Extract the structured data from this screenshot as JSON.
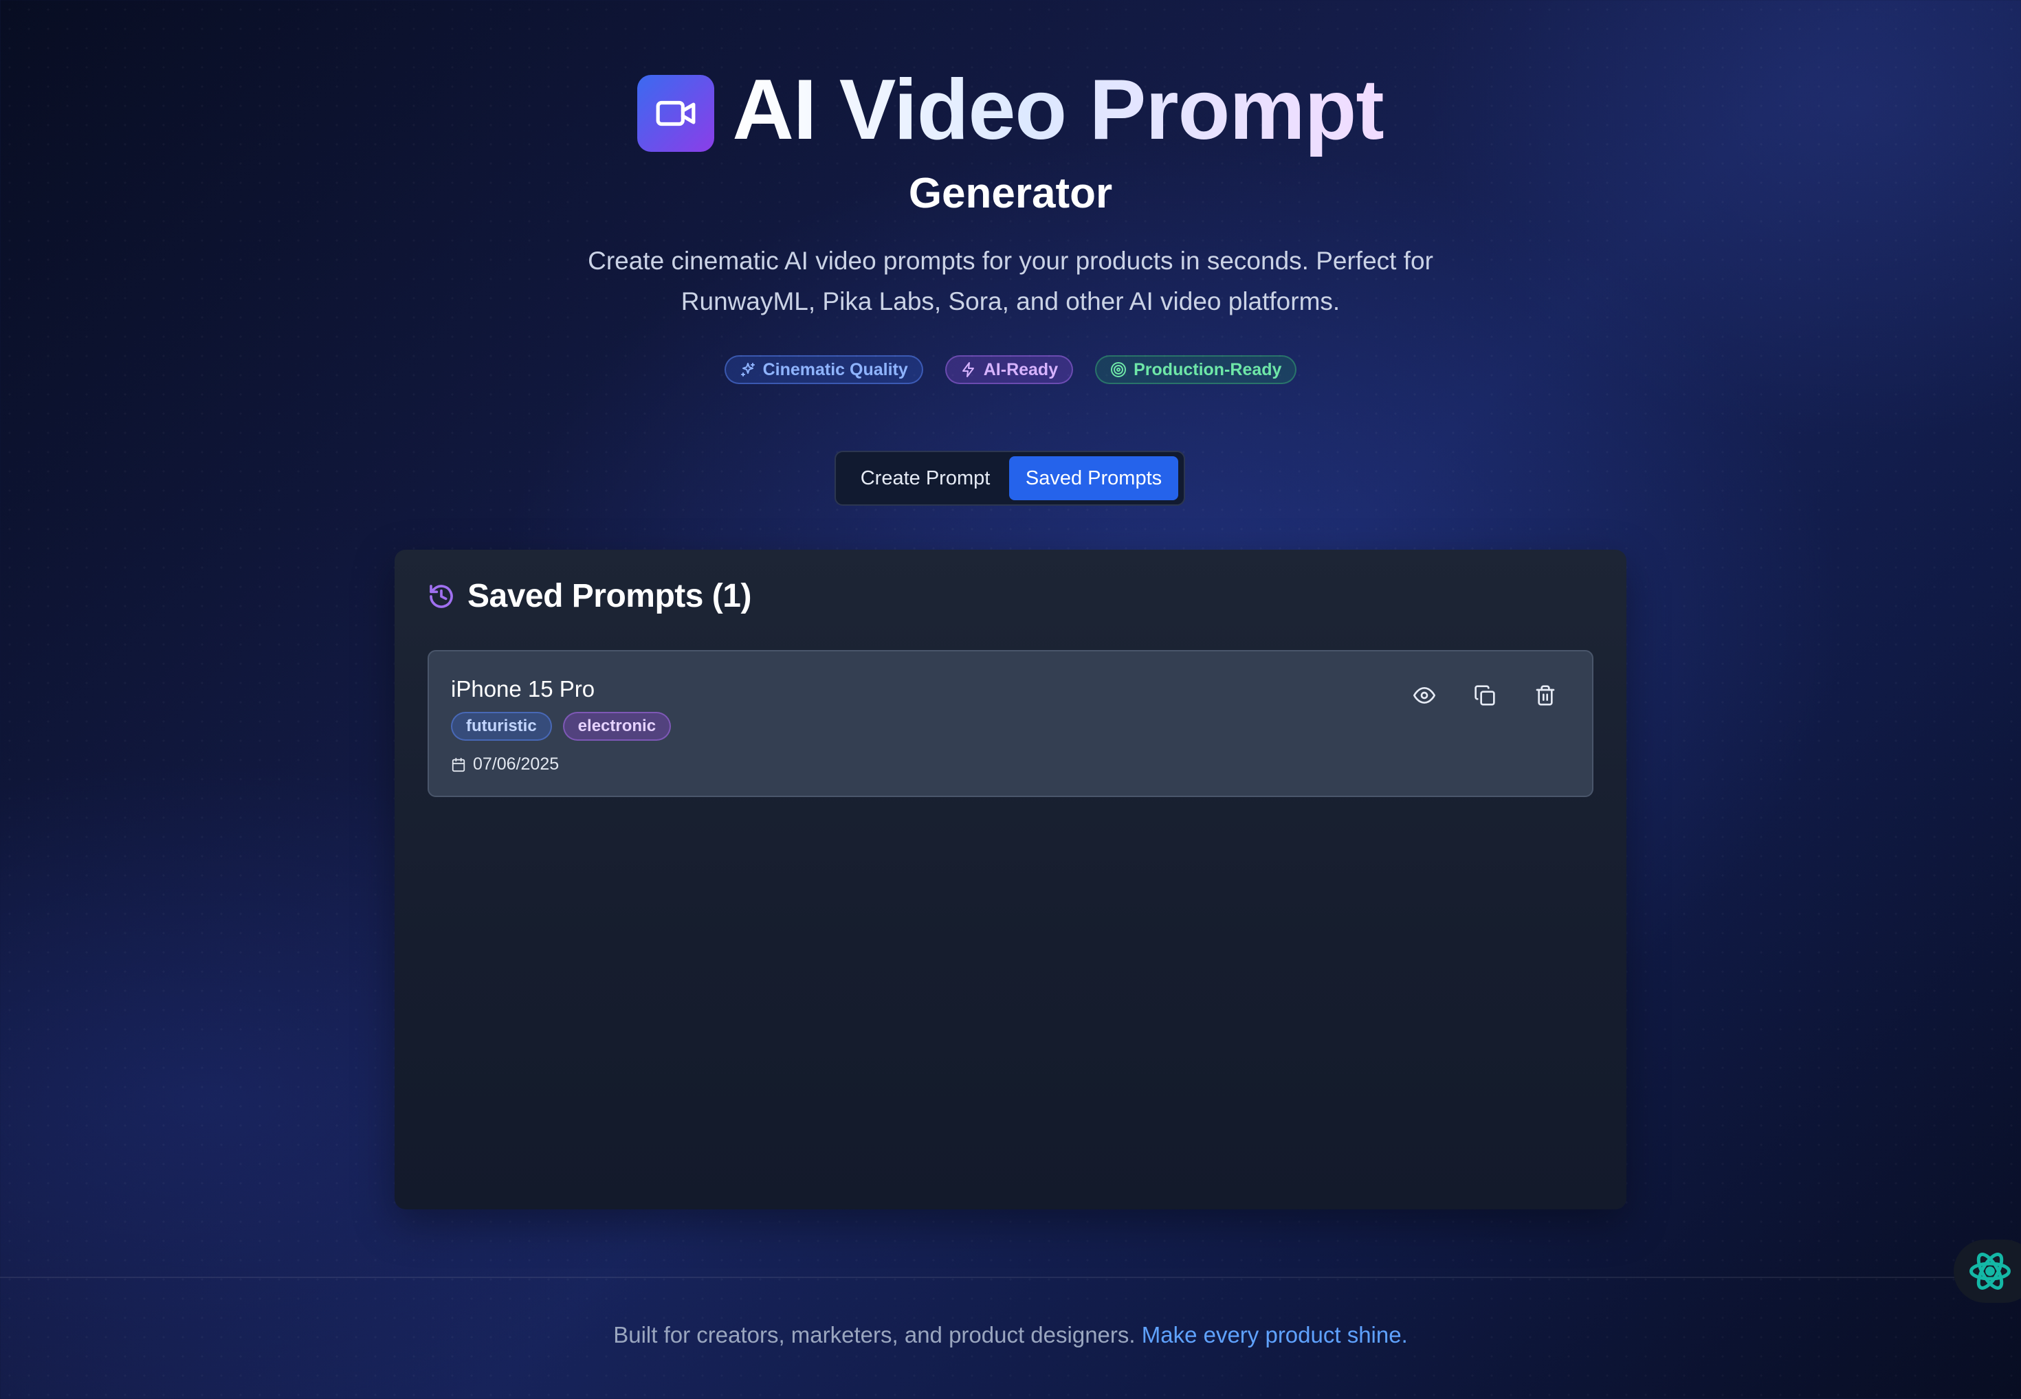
{
  "header": {
    "title": "AI Video Prompt",
    "subtitle": "Generator",
    "description": "Create cinematic AI video prompts for your products in seconds. Perfect for RunwayML, Pika Labs, Sora, and other AI video platforms.",
    "logo_icon": "video-camera-icon",
    "badges": [
      {
        "label": "Cinematic Quality",
        "icon": "sparkles-icon",
        "color": "#8fb4ff"
      },
      {
        "label": "AI-Ready",
        "icon": "lightning-icon",
        "color": "#d7b3ff"
      },
      {
        "label": "Production-Ready",
        "icon": "target-icon",
        "color": "#6ee7a8"
      }
    ]
  },
  "tabs": {
    "create": "Create Prompt",
    "saved": "Saved Prompts",
    "active": "saved"
  },
  "saved_panel": {
    "title": "Saved Prompts (1)",
    "icon": "history-icon",
    "items": [
      {
        "name": "iPhone 15 Pro",
        "tags": [
          "futuristic",
          "electronic"
        ],
        "date": "07/06/2025",
        "actions": [
          "view",
          "copy",
          "delete"
        ]
      }
    ]
  },
  "footer": {
    "text": "Built for creators, marketers, and product designers.",
    "highlight": "Make every product shine."
  },
  "colors": {
    "accent": "#2563eb",
    "logo_gradient_start": "#3b6af0",
    "logo_gradient_end": "#8b3ee8",
    "link": "#5fa2ff",
    "assistant_icon": "#14b8a6"
  }
}
